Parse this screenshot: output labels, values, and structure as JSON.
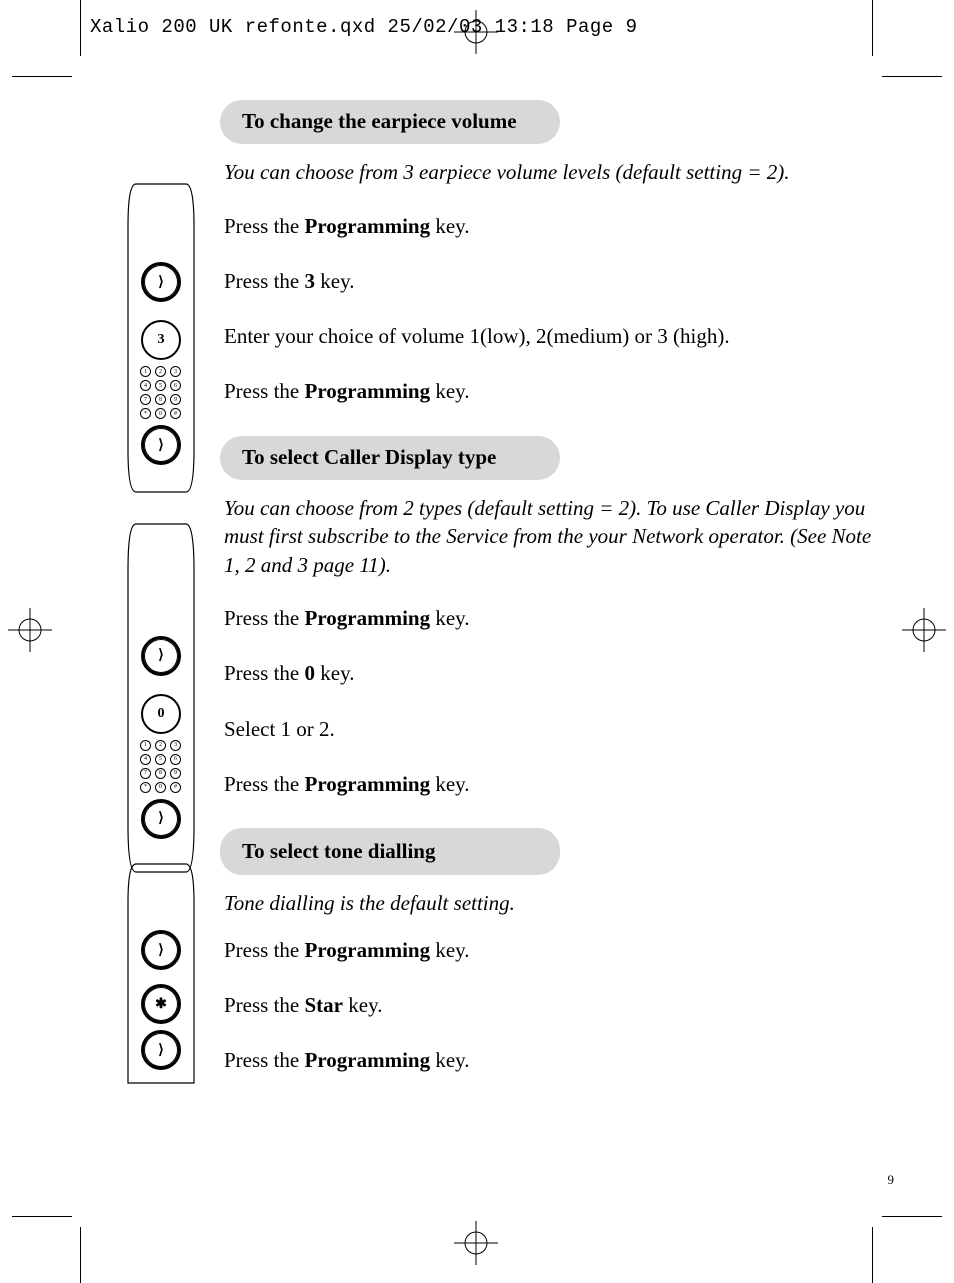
{
  "header": "Xalio 200 UK refonte.qxd  25/02/03  13:18  Page 9",
  "page_number": "9",
  "sections": [
    {
      "title": "To change the earpiece volume",
      "intro": "You can choose from 3 earpiece volume levels (default setting = 2).",
      "steps": [
        {
          "pre": "Press the ",
          "bold": "Programming",
          "post": " key."
        },
        {
          "pre": "Press the ",
          "bold": "3",
          "post": " key."
        },
        {
          "pre": "Enter your choice of volume 1(low), 2(medium) or 3 (high).",
          "bold": "",
          "post": ""
        },
        {
          "pre": "Press the ",
          "bold": "Programming",
          "post": " key."
        }
      ]
    },
    {
      "title": "To select Caller Display type",
      "intro": "You can choose from 2 types (default setting = 2). To use Caller Display you must first subscribe to the Service from the your Network operator. (See Note 1, 2 and 3 page 11).",
      "steps": [
        {
          "pre": "Press the ",
          "bold": "Programming",
          "post": " key."
        },
        {
          "pre": "Press the ",
          "bold": "0",
          "post": " key."
        },
        {
          "pre": "Select 1 or 2.",
          "bold": "",
          "post": ""
        },
        {
          "pre": "Press the ",
          "bold": "Programming",
          "post": " key."
        }
      ]
    },
    {
      "title": "To select tone dialling",
      "intro": "Tone dialling is the default setting.",
      "steps": [
        {
          "pre": "Press the ",
          "bold": "Programming",
          "post": " key."
        },
        {
          "pre": "Press the ",
          "bold": "Star",
          "post": " key."
        },
        {
          "pre": "Press the ",
          "bold": "Programming",
          "post": " key."
        }
      ]
    }
  ],
  "icons": {
    "programming": "programming-key-icon",
    "key3": "3",
    "key0": "0",
    "star": "✱",
    "keypad": "keypad-icon"
  }
}
